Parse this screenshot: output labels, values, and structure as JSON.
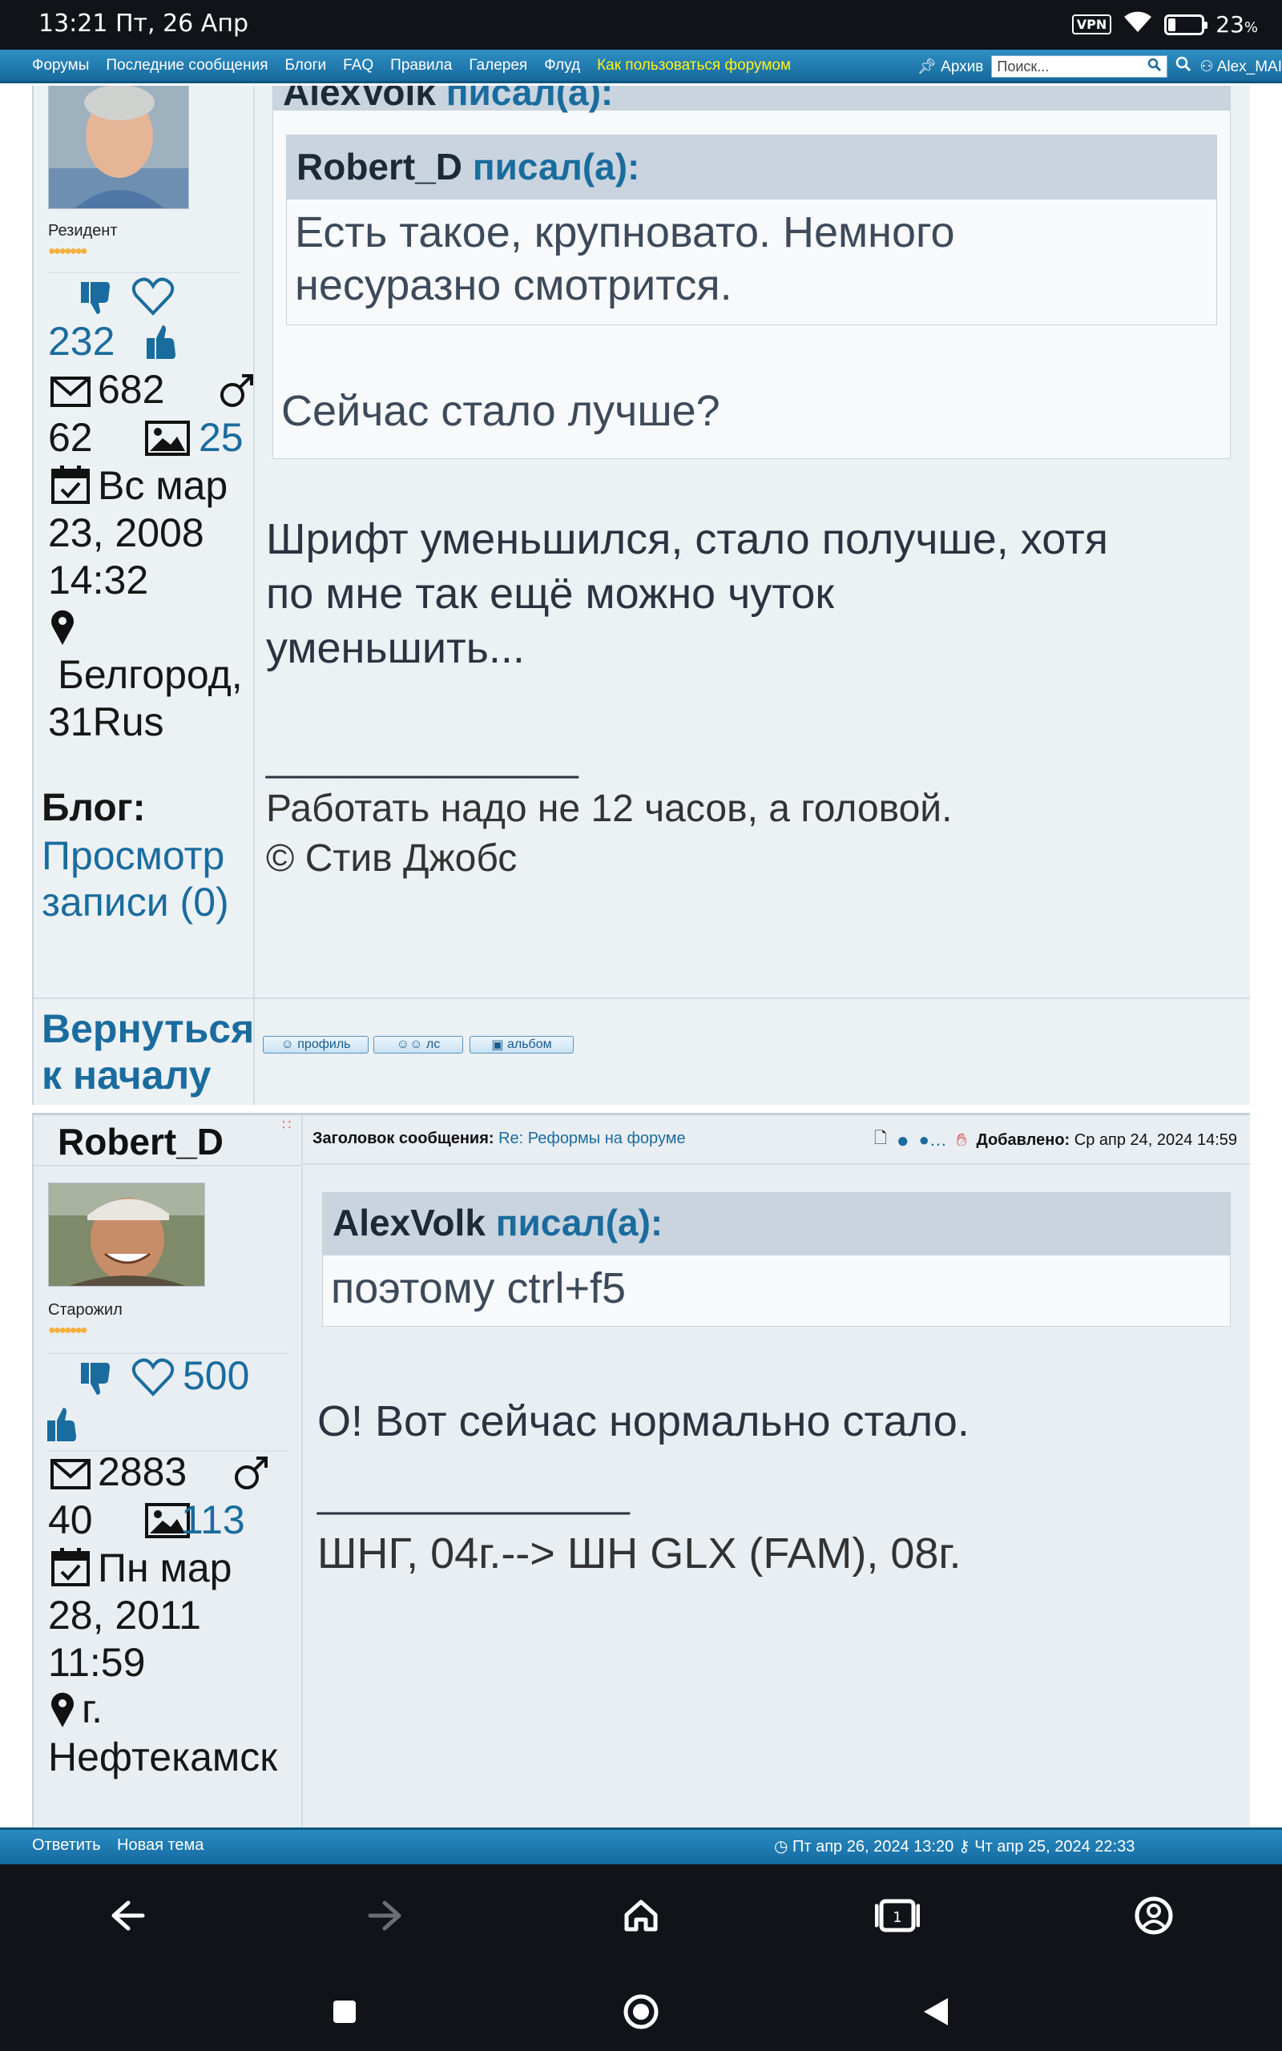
{
  "status_bar": {
    "time_date": "13:21 Пт, 26 Апр",
    "vpn": "VPN",
    "battery_percent": "23",
    "battery_unit": "%",
    "battery_level": 0.23
  },
  "nav": {
    "links": [
      "Форумы",
      "Последние сообщения",
      "Блоги",
      "FAQ",
      "Правила",
      "Галерея",
      "Флуд"
    ],
    "highlight": "Как пользоваться форумом",
    "archive": "Архив",
    "search_placeholder": "Поиск...",
    "user": "Alex_MAI"
  },
  "post1": {
    "author_header_partial": "AlexVolk",
    "wrote_label": "писал(а):",
    "rank": "Резидент",
    "likes": "232",
    "messages": "682",
    "age": "62",
    "photos": "25",
    "reg_date_line1": "Вс мар",
    "reg_date_line2": "23, 2008",
    "reg_time": "14:32",
    "location_line1": "Белгород,",
    "location_line2": "31Rus",
    "blog_label": "Блог:",
    "blog_link_line1": "Просмотр",
    "blog_link_line2": "записи (0)",
    "nested_quote_author": "Robert_D",
    "nested_quote_text_line1": "Есть такое, крупновато. Немного",
    "nested_quote_text_line2": "несуразно смотрится.",
    "quote_reply": "Сейчас стало лучше?",
    "message_line1": "Шрифт уменьшился, стало получше, хотя",
    "message_line2": "по мне так ещё можно чуток",
    "message_line3": "уменьшить...",
    "signature_rule": "_________________",
    "signature_line1": "Работать надо не 12 часов, а головой.",
    "signature_line2": "© Стив Джобс",
    "back_to_top_line1": "Вернуться",
    "back_to_top_line2": "к началу",
    "buttons": [
      "профиль",
      "лс",
      "альбом"
    ]
  },
  "post2": {
    "author": "Robert_D",
    "subject_label": "Заголовок сообщения:",
    "subject": "Re: Реформы на форуме",
    "added_label": "Добавлено:",
    "added_date": "Ср апр 24, 2024 14:59",
    "rank": "Старожил",
    "likes": "500",
    "messages": "2883",
    "age": "40",
    "photos": "113",
    "reg_date_line1": "Пн мар",
    "reg_date_line2": "28, 2011",
    "reg_time": "11:59",
    "location_line1": "г.",
    "location_line2": "Нефтекамск",
    "quote_author": "AlexVolk",
    "wrote_label": "писал(а):",
    "quote_text": "поэтому ctrl+f5",
    "message": "О! Вот сейчас нормально стало.",
    "signature_rule": "_________________",
    "signature": "ШНГ, 04г.--> ШН GLX (FAM), 08г."
  },
  "bottom_bar": {
    "reply": "Ответить",
    "new_topic": "Новая тема",
    "now_time": "Пт апр 26, 2024 13:20",
    "last_visit": "Чт апр 25, 2024 22:33"
  }
}
